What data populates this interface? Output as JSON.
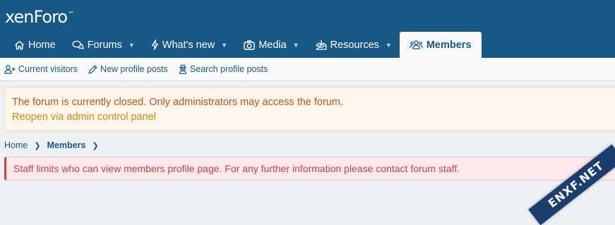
{
  "header": {
    "logo_text": "xenForo",
    "logo_tm": "™"
  },
  "nav": {
    "tabs": [
      {
        "label": "Home",
        "icon": "home-icon",
        "has_caret": false
      },
      {
        "label": "Forums",
        "icon": "comments-icon",
        "has_caret": true
      },
      {
        "label": "What's new",
        "icon": "bolt-icon",
        "has_caret": true
      },
      {
        "label": "Media",
        "icon": "camera-icon",
        "has_caret": true
      },
      {
        "label": "Resources",
        "icon": "inbox-icon",
        "has_caret": true
      },
      {
        "label": "Members",
        "icon": "users-icon",
        "has_caret": false,
        "selected": true
      }
    ]
  },
  "subnav": {
    "items": [
      {
        "label": "Current visitors",
        "icon": "user-plus-icon"
      },
      {
        "label": "New profile posts",
        "icon": "pencil-icon"
      },
      {
        "label": "Search profile posts",
        "icon": "user-secret-icon"
      }
    ]
  },
  "notice": {
    "text": "The forum is currently closed. Only administrators may access the forum.",
    "link": "Reopen via admin control panel"
  },
  "breadcrumb": {
    "items": [
      "Home",
      "Members"
    ]
  },
  "error": {
    "text": "Staff limits who can view members profile page. For any further information please contact forum staff."
  },
  "watermark": {
    "text": "ENXF.NET"
  },
  "colors": {
    "header_bg": "#185886",
    "notice_bg": "#fef6eb",
    "error_bg": "#fde9e9",
    "error_text": "#c84448"
  }
}
